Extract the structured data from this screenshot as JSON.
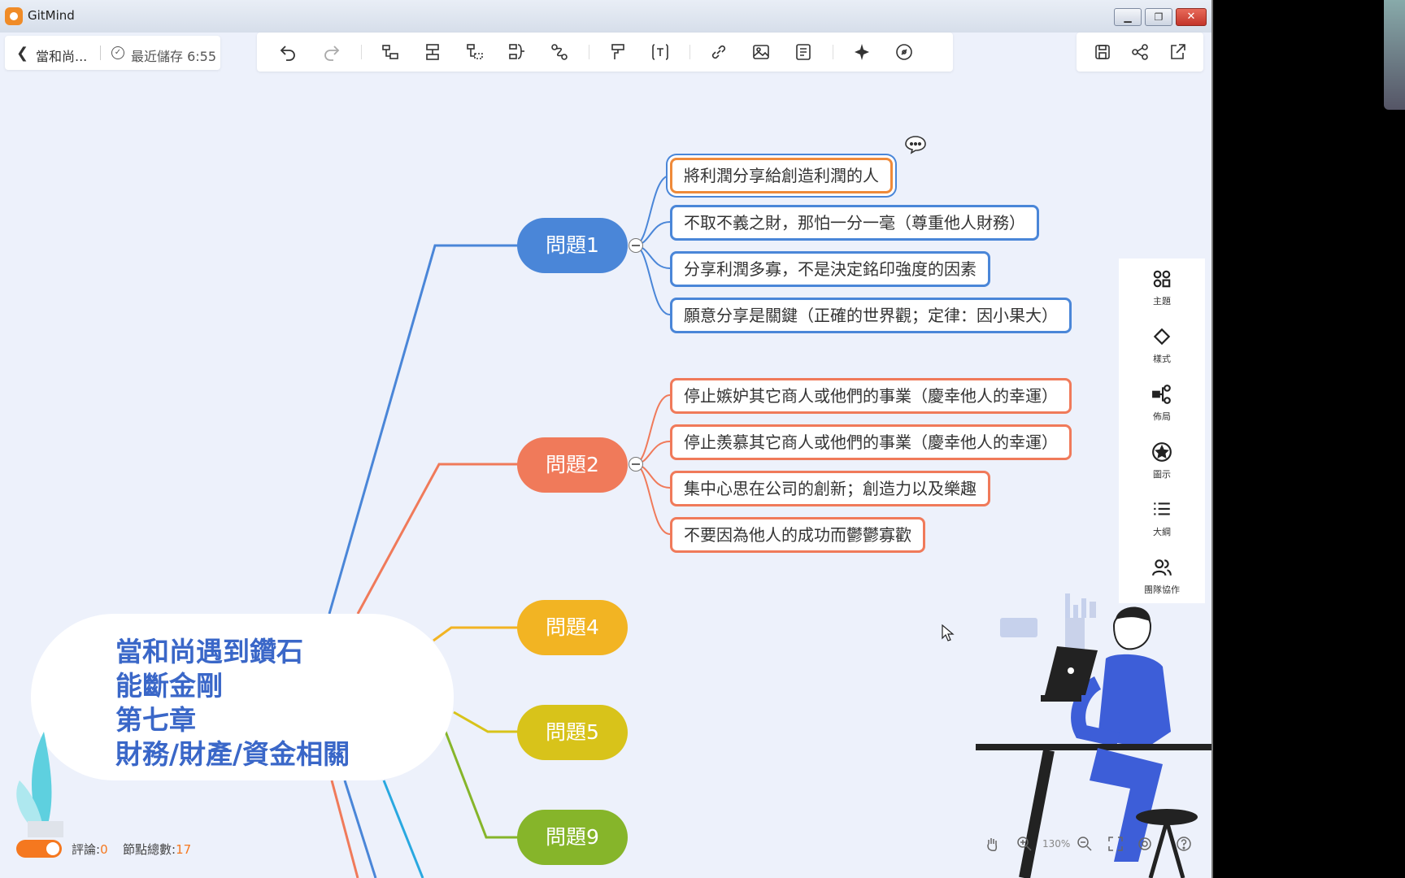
{
  "window": {
    "title": "GitMind",
    "minimize": "▁",
    "restore": "❐",
    "close": "✕"
  },
  "header": {
    "doc_name": "當和尚...",
    "save_status": "最近儲存 6:55"
  },
  "toolbar": {
    "tools": [
      "undo-icon",
      "redo-icon",
      "add-child-icon",
      "add-sibling-icon",
      "add-parent-icon",
      "summary-icon",
      "relation-icon",
      "format-painter-icon",
      "text-box-icon",
      "link-icon",
      "image-icon",
      "note-icon",
      "style-magic-icon",
      "explore-icon"
    ]
  },
  "right_actions": [
    "save-icon",
    "share-icon",
    "export-icon"
  ],
  "mindmap": {
    "root": {
      "lines": [
        "當和尚遇到鑽石",
        "能斷金剛",
        "第七章",
        "財務/財產/資金相關"
      ]
    },
    "branches": [
      {
        "label": "問題1",
        "color": "#4a86d8",
        "children": [
          "將利潤分享給創造利潤的人",
          "不取不義之財，那怕一分一毫（尊重他人財務）",
          "分享利潤多寡，不是決定銘印強度的因素",
          "願意分享是關鍵（正確的世界觀；定律：因小果大）"
        ]
      },
      {
        "label": "問題2",
        "color": "#f07a5a",
        "children": [
          "停止嫉妒其它商人或他們的事業（慶幸他人的幸運）",
          "停止羨慕其它商人或他們的事業（慶幸他人的幸運）",
          "集中心思在公司的創新；創造力以及樂趣",
          "不要因為他人的成功而鬱鬱寡歡"
        ]
      },
      {
        "label": "問題4",
        "color": "#f2b423",
        "children": []
      },
      {
        "label": "問題5",
        "color": "#d8c31a",
        "children": []
      },
      {
        "label": "問題9",
        "color": "#86b52a",
        "children": []
      }
    ]
  },
  "sidebar": {
    "items": [
      {
        "icon": "theme-icon",
        "label": "主題"
      },
      {
        "icon": "style-icon",
        "label": "樣式"
      },
      {
        "icon": "layout-icon",
        "label": "佈局"
      },
      {
        "icon": "icon-icon",
        "label": "圖示"
      },
      {
        "icon": "outline-icon",
        "label": "大綱"
      },
      {
        "icon": "team-icon",
        "label": "團隊協作"
      }
    ]
  },
  "footer": {
    "comments_label": "評論:",
    "comments_count": "0",
    "nodes_label": "節點總數:",
    "nodes_count": "17",
    "zoom": "130%"
  },
  "colors": {
    "accent": "#f5781f",
    "blue": "#4a86d8",
    "orange": "#f07a5a"
  }
}
